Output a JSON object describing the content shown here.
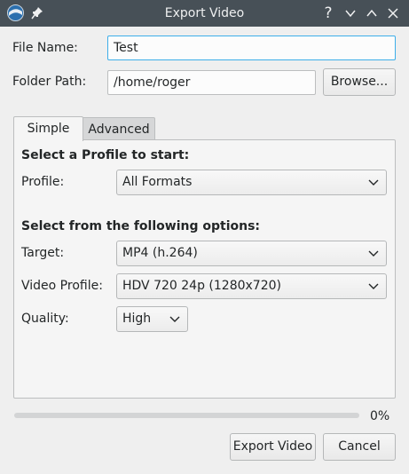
{
  "window": {
    "title": "Export Video",
    "app_icon": "kdenlive-app-icon",
    "pin_icon": "pin-icon",
    "help_label": "?"
  },
  "form": {
    "file_name_label": "File Name:",
    "file_name_value": "Test",
    "folder_path_label": "Folder Path:",
    "folder_path_value": "/home/roger",
    "browse_label": "Browse..."
  },
  "tabs": [
    {
      "label": "Simple",
      "active": true
    },
    {
      "label": "Advanced",
      "active": false
    }
  ],
  "simple": {
    "profile_heading": "Select a Profile to start:",
    "profile_label": "Profile:",
    "profile_value": "All Formats",
    "options_heading": "Select from the following options:",
    "target_label": "Target:",
    "target_value": "MP4 (h.264)",
    "video_profile_label": "Video Profile:",
    "video_profile_value": "HDV 720 24p (1280x720)",
    "quality_label": "Quality:",
    "quality_value": "High"
  },
  "progress": {
    "value": 0,
    "text": "0%"
  },
  "actions": {
    "export_label": "Export Video",
    "cancel_label": "Cancel"
  },
  "colors": {
    "titlebar": "#475057",
    "accent": "#3daee9"
  }
}
